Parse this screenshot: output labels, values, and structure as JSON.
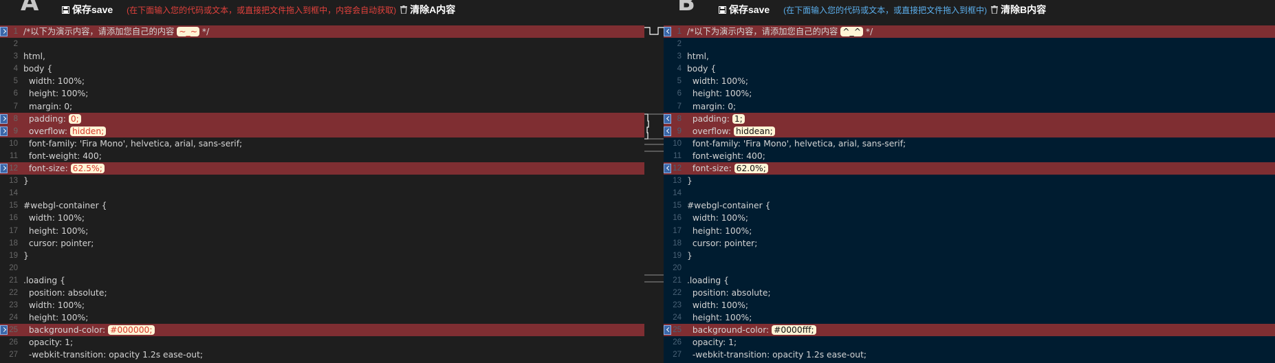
{
  "panelA": {
    "letter": "A",
    "save_label": "保存save",
    "hint": "(在下面输入您的代码或文本，或直接把文件拖入到框中，内容会自动获取)",
    "clear_label": "清除A内容",
    "lines": [
      {
        "n": "1",
        "diff": true,
        "parts": [
          {
            "t": "/*以下为演示内容，请添加您自己的内容 "
          },
          {
            "t": "~_~",
            "hl": true
          },
          {
            "t": " */"
          }
        ]
      },
      {
        "n": "2",
        "parts": [
          {
            "t": ""
          }
        ]
      },
      {
        "n": "3",
        "parts": [
          {
            "t": "html,"
          }
        ]
      },
      {
        "n": "4",
        "parts": [
          {
            "t": "body {"
          }
        ]
      },
      {
        "n": "5",
        "parts": [
          {
            "t": "  width: 100%;"
          }
        ]
      },
      {
        "n": "6",
        "parts": [
          {
            "t": "  height: 100%;"
          }
        ]
      },
      {
        "n": "7",
        "parts": [
          {
            "t": "  margin: 0;"
          }
        ]
      },
      {
        "n": "8",
        "diff": true,
        "parts": [
          {
            "t": "  padding: "
          },
          {
            "t": "0;",
            "hl": true
          }
        ]
      },
      {
        "n": "9",
        "diff": true,
        "parts": [
          {
            "t": "  overflow: "
          },
          {
            "t": "hidden;",
            "hl": true
          }
        ]
      },
      {
        "n": "10",
        "parts": [
          {
            "t": "  font-family: 'Fira Mono', helvetica, arial, sans-serif;"
          }
        ]
      },
      {
        "n": "11",
        "parts": [
          {
            "t": "  font-weight: 400;"
          }
        ]
      },
      {
        "n": "12",
        "diff": true,
        "parts": [
          {
            "t": "  font-size: "
          },
          {
            "t": "62.5%;",
            "hl": true
          }
        ]
      },
      {
        "n": "13",
        "parts": [
          {
            "t": "}"
          }
        ]
      },
      {
        "n": "14",
        "parts": [
          {
            "t": ""
          }
        ]
      },
      {
        "n": "15",
        "parts": [
          {
            "t": "#webgl-container {"
          }
        ]
      },
      {
        "n": "16",
        "parts": [
          {
            "t": "  width: 100%;"
          }
        ]
      },
      {
        "n": "17",
        "parts": [
          {
            "t": "  height: 100%;"
          }
        ]
      },
      {
        "n": "18",
        "parts": [
          {
            "t": "  cursor: pointer;"
          }
        ]
      },
      {
        "n": "19",
        "parts": [
          {
            "t": "}"
          }
        ]
      },
      {
        "n": "20",
        "parts": [
          {
            "t": ""
          }
        ]
      },
      {
        "n": "21",
        "parts": [
          {
            "t": ".loading {"
          }
        ]
      },
      {
        "n": "22",
        "parts": [
          {
            "t": "  position: absolute;"
          }
        ]
      },
      {
        "n": "23",
        "parts": [
          {
            "t": "  width: 100%;"
          }
        ]
      },
      {
        "n": "24",
        "parts": [
          {
            "t": "  height: 100%;"
          }
        ]
      },
      {
        "n": "25",
        "diff": true,
        "parts": [
          {
            "t": "  background-color: "
          },
          {
            "t": "#000000;",
            "hl": true
          }
        ]
      },
      {
        "n": "26",
        "parts": [
          {
            "t": "  opacity: 1;"
          }
        ]
      },
      {
        "n": "27",
        "parts": [
          {
            "t": "  -webkit-transition: opacity 1.2s ease-out;"
          }
        ]
      }
    ]
  },
  "panelB": {
    "letter": "B",
    "save_label": "保存save",
    "hint": "(在下面输入您的代码或文本，或直接把文件拖入到框中)",
    "clear_label": "清除B内容",
    "lines": [
      {
        "n": "1",
        "diff": true,
        "parts": [
          {
            "t": "/*以下为演示内容，请添加您自己的内容 "
          },
          {
            "t": "^_^",
            "hl": true
          },
          {
            "t": " */"
          }
        ]
      },
      {
        "n": "2",
        "parts": [
          {
            "t": ""
          }
        ]
      },
      {
        "n": "3",
        "parts": [
          {
            "t": "html,"
          }
        ]
      },
      {
        "n": "4",
        "parts": [
          {
            "t": "body {"
          }
        ]
      },
      {
        "n": "5",
        "parts": [
          {
            "t": "  width: 100%;"
          }
        ]
      },
      {
        "n": "6",
        "parts": [
          {
            "t": "  height: 100%;"
          }
        ]
      },
      {
        "n": "7",
        "parts": [
          {
            "t": "  margin: 0;"
          }
        ]
      },
      {
        "n": "8",
        "diff": true,
        "parts": [
          {
            "t": "  padding: "
          },
          {
            "t": "1;",
            "hl": true
          }
        ]
      },
      {
        "n": "9",
        "diff": true,
        "parts": [
          {
            "t": "  overflow: "
          },
          {
            "t": "hiddean;",
            "hl": true
          }
        ]
      },
      {
        "n": "10",
        "parts": [
          {
            "t": "  font-family: 'Fira Mono', helvetica, arial, sans-serif;"
          }
        ]
      },
      {
        "n": "11",
        "parts": [
          {
            "t": "  font-weight: 400;"
          }
        ]
      },
      {
        "n": "12",
        "diff": true,
        "parts": [
          {
            "t": "  font-size: "
          },
          {
            "t": "62.0%;",
            "hl": true
          }
        ]
      },
      {
        "n": "13",
        "parts": [
          {
            "t": "}"
          }
        ]
      },
      {
        "n": "14",
        "parts": [
          {
            "t": ""
          }
        ]
      },
      {
        "n": "15",
        "parts": [
          {
            "t": "#webgl-container {"
          }
        ]
      },
      {
        "n": "16",
        "parts": [
          {
            "t": "  width: 100%;"
          }
        ]
      },
      {
        "n": "17",
        "parts": [
          {
            "t": "  height: 100%;"
          }
        ]
      },
      {
        "n": "18",
        "parts": [
          {
            "t": "  cursor: pointer;"
          }
        ]
      },
      {
        "n": "19",
        "parts": [
          {
            "t": "}"
          }
        ]
      },
      {
        "n": "20",
        "parts": [
          {
            "t": ""
          }
        ]
      },
      {
        "n": "21",
        "parts": [
          {
            "t": ".loading {"
          }
        ]
      },
      {
        "n": "22",
        "parts": [
          {
            "t": "  position: absolute;"
          }
        ]
      },
      {
        "n": "23",
        "parts": [
          {
            "t": "  width: 100%;"
          }
        ]
      },
      {
        "n": "24",
        "parts": [
          {
            "t": "  height: 100%;"
          }
        ]
      },
      {
        "n": "25",
        "diff": true,
        "parts": [
          {
            "t": "  background-color: "
          },
          {
            "t": "#0000fff;",
            "hl": true
          }
        ]
      },
      {
        "n": "26",
        "parts": [
          {
            "t": "  opacity: 1;"
          }
        ]
      },
      {
        "n": "27",
        "parts": [
          {
            "t": "  -webkit-transition: opacity 1.2s ease-out;"
          }
        ]
      }
    ]
  },
  "colors": {
    "diff_row": "#7f2e32",
    "pane_a_bg": "#1e1e1e",
    "pane_b_bg": "#001c30",
    "hint_a": "#e2413c",
    "hint_b": "#5cb0ee",
    "marker": "#3a66a8"
  },
  "icons": [
    "floppy-disk-icon",
    "trash-icon",
    "arrow-right-icon",
    "arrow-left-icon"
  ]
}
